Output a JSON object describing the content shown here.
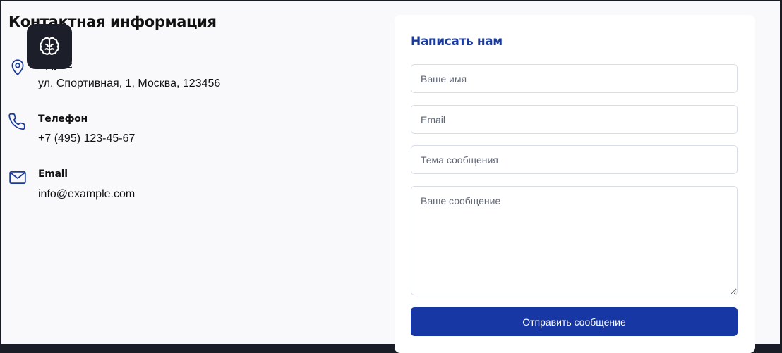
{
  "contact": {
    "title": "Контактная информация",
    "items": [
      {
        "icon": "map-pin-icon",
        "label": "Адрес",
        "value": "ул. Спортивная, 1, Москва, 123456"
      },
      {
        "icon": "phone-icon",
        "label": "Телефон",
        "value": "+7 (495) 123-45-67"
      },
      {
        "icon": "mail-icon",
        "label": "Email",
        "value": "info@example.com"
      }
    ]
  },
  "badge": {
    "icon": "brain-icon"
  },
  "form": {
    "title": "Написать нам",
    "name_placeholder": "Ваше имя",
    "email_placeholder": "Email",
    "subject_placeholder": "Тема сообщения",
    "message_placeholder": "Ваше сообщение",
    "submit_label": "Отправить сообщение"
  },
  "colors": {
    "accent": "#1737a5",
    "heading_blue": "#1a3a9c",
    "page_bg": "#f9f9fc",
    "dark_frame": "#1a1d26"
  }
}
